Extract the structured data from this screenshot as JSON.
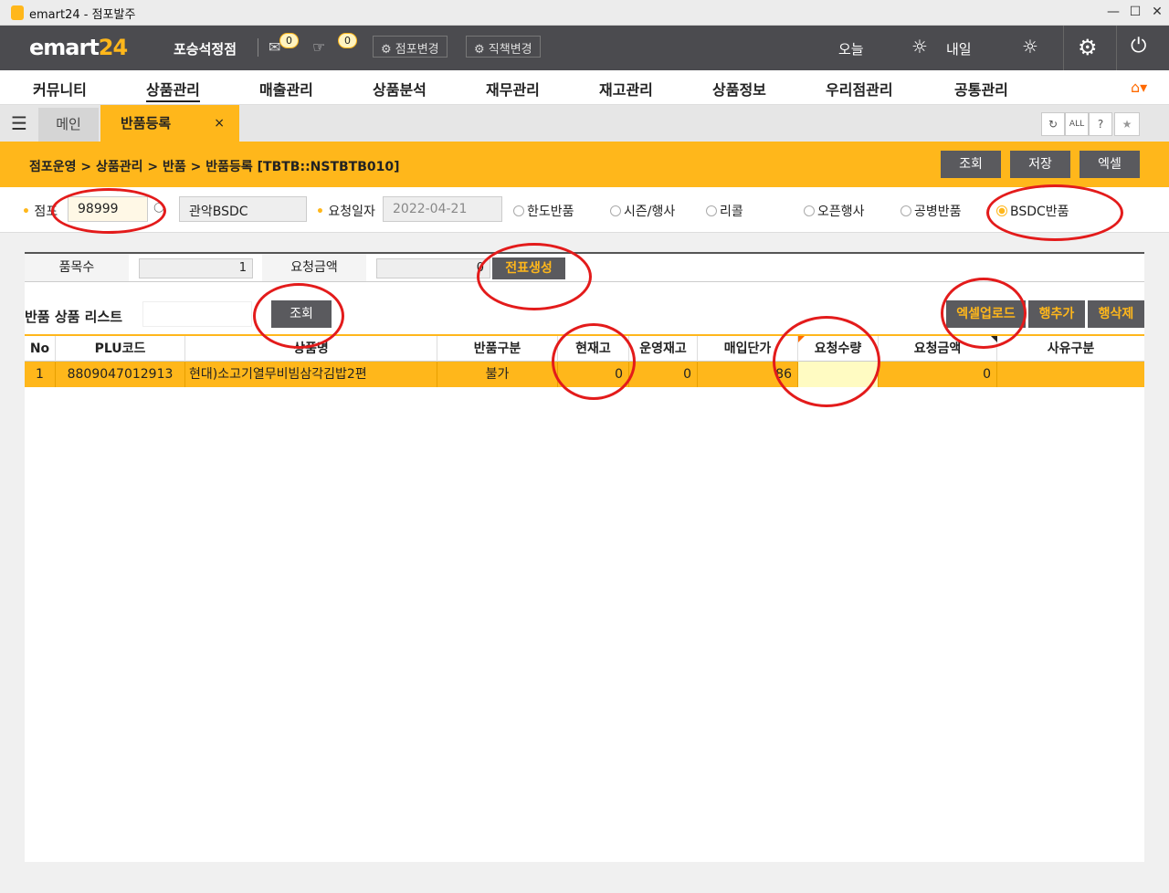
{
  "window": {
    "title": "emart24 - 점포발주"
  },
  "header": {
    "brand_left": "emart",
    "brand_right": "24",
    "store_name": "포승석정점",
    "msg_count": "0",
    "hand_count": "0",
    "store_change": "점포변경",
    "role_change": "직책변경",
    "today": "오늘",
    "tomorrow": "내일"
  },
  "nav": {
    "items": [
      "커뮤니티",
      "상품관리",
      "매출관리",
      "상품분석",
      "재무관리",
      "재고관리",
      "상품정보",
      "우리점관리",
      "공통관리"
    ]
  },
  "tabs": {
    "main": "메인",
    "active": "반품등록",
    "close": "×"
  },
  "toolbar_icons": {
    "refresh": "↻",
    "all": "ALL",
    "help": "?",
    "favorite": "★"
  },
  "breadcrumb": "점포운영 > 상품관리 > 반품 > 반품등록 [TBTB::NSTBTB010]",
  "actions": {
    "search": "조회",
    "save": "저장",
    "excel": "엑셀"
  },
  "search": {
    "store_label": "점포",
    "store_code": "98999",
    "store_name": "관악BSDC",
    "date_label": "요청일자",
    "date_value": "2022-04-21",
    "radios": [
      "한도반품",
      "시즌/행사",
      "리콜",
      "오픈행사",
      "공병반품",
      "BSDC반품"
    ],
    "selected_radio": "BSDC반품"
  },
  "summary": {
    "item_count_label": "품목수",
    "item_count": "1",
    "amount_label": "요청금액",
    "amount": "0",
    "create_slip": "전표생성"
  },
  "list": {
    "title": "반품 상품 리스트",
    "search_btn": "조회",
    "excel_upload": "엑셀업로드",
    "add_row": "행추가",
    "delete_row": "행삭제",
    "columns": [
      "No",
      "PLU코드",
      "상품명",
      "반품구분",
      "현재고",
      "운영재고",
      "매입단가",
      "요청수량",
      "요청금액",
      "사유구분"
    ],
    "rows": [
      {
        "no": "1",
        "plu": "8809047012913",
        "name": "현대)소고기열무비빔삼각김밥2편",
        "type": "불가",
        "stock": "0",
        "op_stock": "0",
        "unit_price": "86",
        "req_qty": "",
        "req_amount": "0",
        "reason": ""
      }
    ]
  }
}
